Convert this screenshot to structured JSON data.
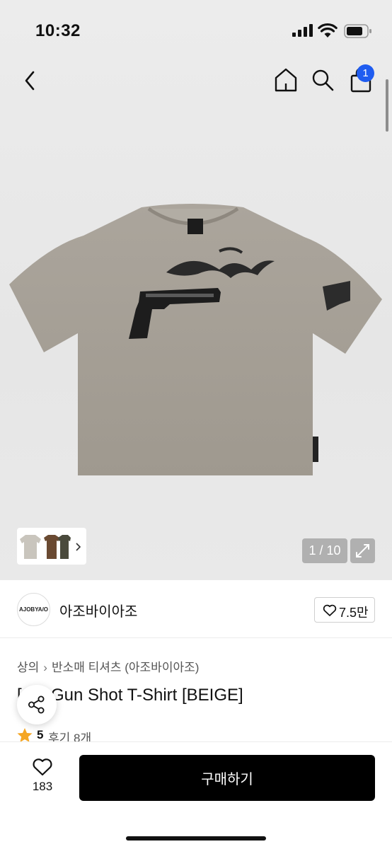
{
  "status_bar": {
    "time": "10:32"
  },
  "nav": {
    "cart_count": "1"
  },
  "gallery": {
    "counter": "1 / 10",
    "thumbnail_colors": [
      "#c9c5bd",
      "#6a4a32",
      "#4a4a3c"
    ]
  },
  "brand": {
    "logo_text": "AJOBYA/O",
    "name": "아조바이아조",
    "likes": "7.5만"
  },
  "breadcrumb": [
    "상의",
    "반소매 티셔츠 (아조바이아조)"
  ],
  "product": {
    "title": "[AJ] Gun Shot T-Shirt [BEIGE]",
    "rating": "5",
    "reviews": "후기 8개"
  },
  "bottom_bar": {
    "wish_count": "183",
    "buy_label": "구매하기"
  },
  "colors": {
    "accent_blue": "#1f5cf0",
    "shirt_beige": "#a59f96",
    "star": "#f5a623"
  }
}
